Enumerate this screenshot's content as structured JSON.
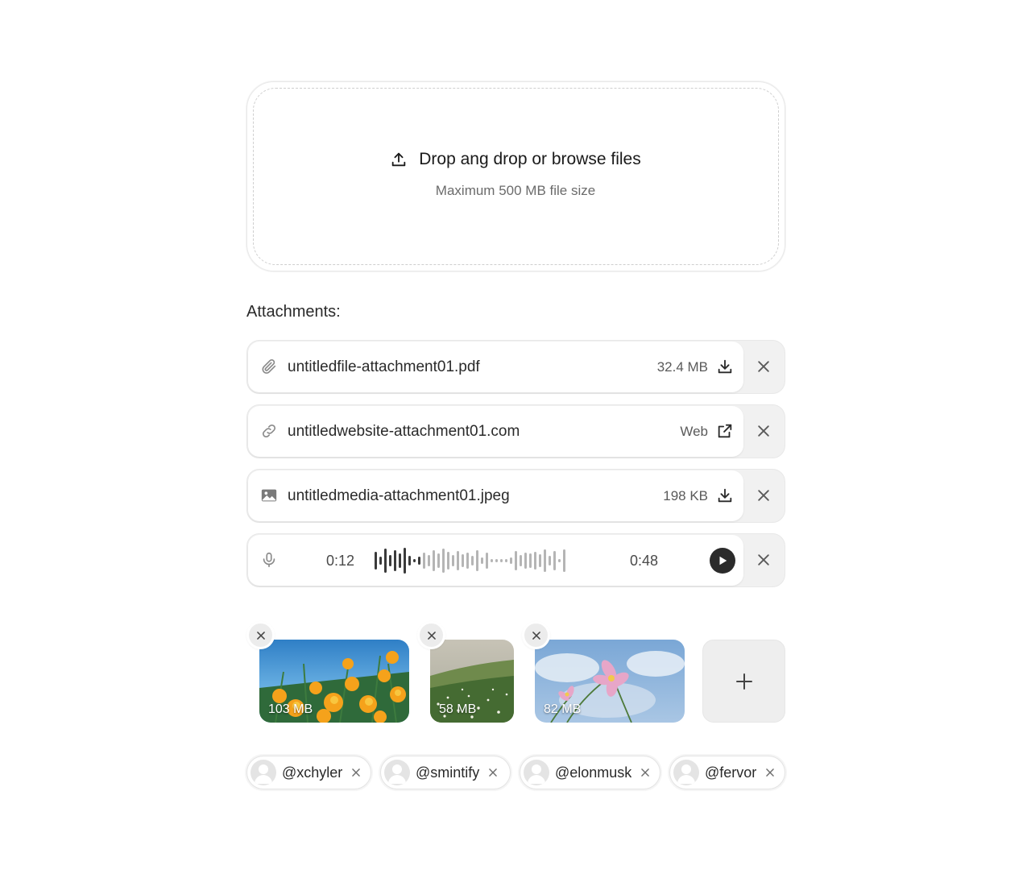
{
  "dropzone": {
    "title": "Drop ang drop or browse files",
    "subtitle": "Maximum 500 MB file size"
  },
  "attachments_label": "Attachments:",
  "attachments": [
    {
      "icon": "paperclip-icon",
      "name": "untitledfile-attachment01.pdf",
      "meta": "32.4 MB",
      "action": "download-icon"
    },
    {
      "icon": "link-icon",
      "name": "untitledwebsite-attachment01.com",
      "meta": "Web",
      "action": "external-link-icon"
    },
    {
      "icon": "image-icon",
      "name": "untitledmedia-attachment01.jpeg",
      "meta": "198 KB",
      "action": "download-icon"
    }
  ],
  "audio": {
    "icon": "microphone-icon",
    "current_time": "0:12",
    "duration": "0:48",
    "progress": 0.25
  },
  "thumbnails": [
    {
      "size": "103 MB",
      "subject": "orange poppies"
    },
    {
      "size": "58 MB",
      "subject": "meadow"
    },
    {
      "size": "82 MB",
      "subject": "pink cosmos flower"
    }
  ],
  "mentions": [
    {
      "handle": "@xchyler"
    },
    {
      "handle": "@smintify"
    },
    {
      "handle": "@elonmusk"
    },
    {
      "handle": "@fervor"
    }
  ],
  "colors": {
    "text": "#2a2a2a",
    "muted": "#6b6b6b",
    "row_bg": "#f1f1f1",
    "play": "#2b2b2b"
  }
}
